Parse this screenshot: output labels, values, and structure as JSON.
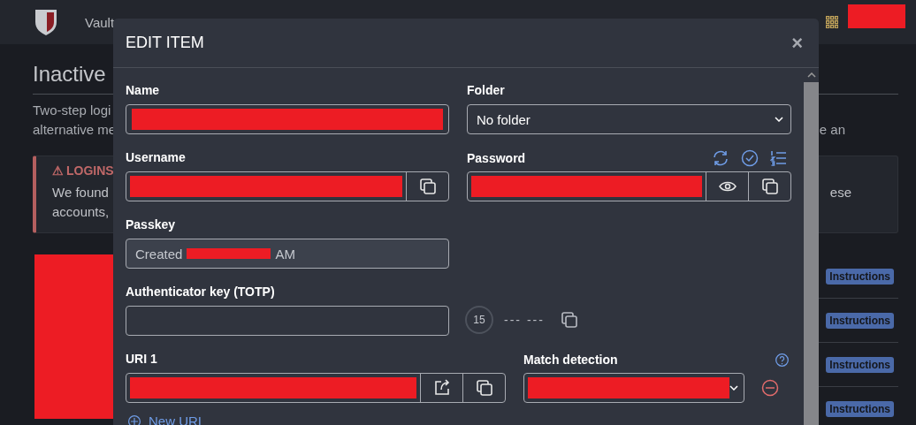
{
  "header": {
    "nav": [
      {
        "label": "Vault"
      }
    ],
    "account": {
      "redacted": true
    }
  },
  "page": {
    "title": "Inactive",
    "intro": [
      {
        "left": "Two-step logi"
      },
      {
        "left": "alternative me",
        "right": "e an"
      }
    ],
    "alert": {
      "icon": "⚠",
      "title": "LOGINS",
      "lines": [
        {
          "left": "We found",
          "right": "ese"
        },
        {
          "left": "accounts,"
        }
      ]
    },
    "side_block": {
      "redacted": true
    },
    "rows": [
      {
        "badge": "Instructions"
      },
      {
        "badge": "Instructions"
      },
      {
        "badge": "Instructions"
      },
      {
        "badge": "Instructions"
      }
    ]
  },
  "modal": {
    "title": "EDIT ITEM",
    "close": "×",
    "name": {
      "label": "Name",
      "redacted": true
    },
    "folder": {
      "label": "Folder",
      "value": "No folder"
    },
    "username": {
      "label": "Username",
      "redacted": true
    },
    "password": {
      "label": "Password",
      "redacted": true
    },
    "passkey": {
      "label": "Passkey",
      "prefix": "Created",
      "suffix": "AM",
      "redacted": true
    },
    "totp": {
      "label": "Authenticator key (TOTP)",
      "countdown": "15",
      "code": "--- ---"
    },
    "uri": {
      "label": "URI 1",
      "redacted": true
    },
    "match": {
      "label": "Match detection",
      "redacted": true
    },
    "new_uri": "New URI"
  }
}
